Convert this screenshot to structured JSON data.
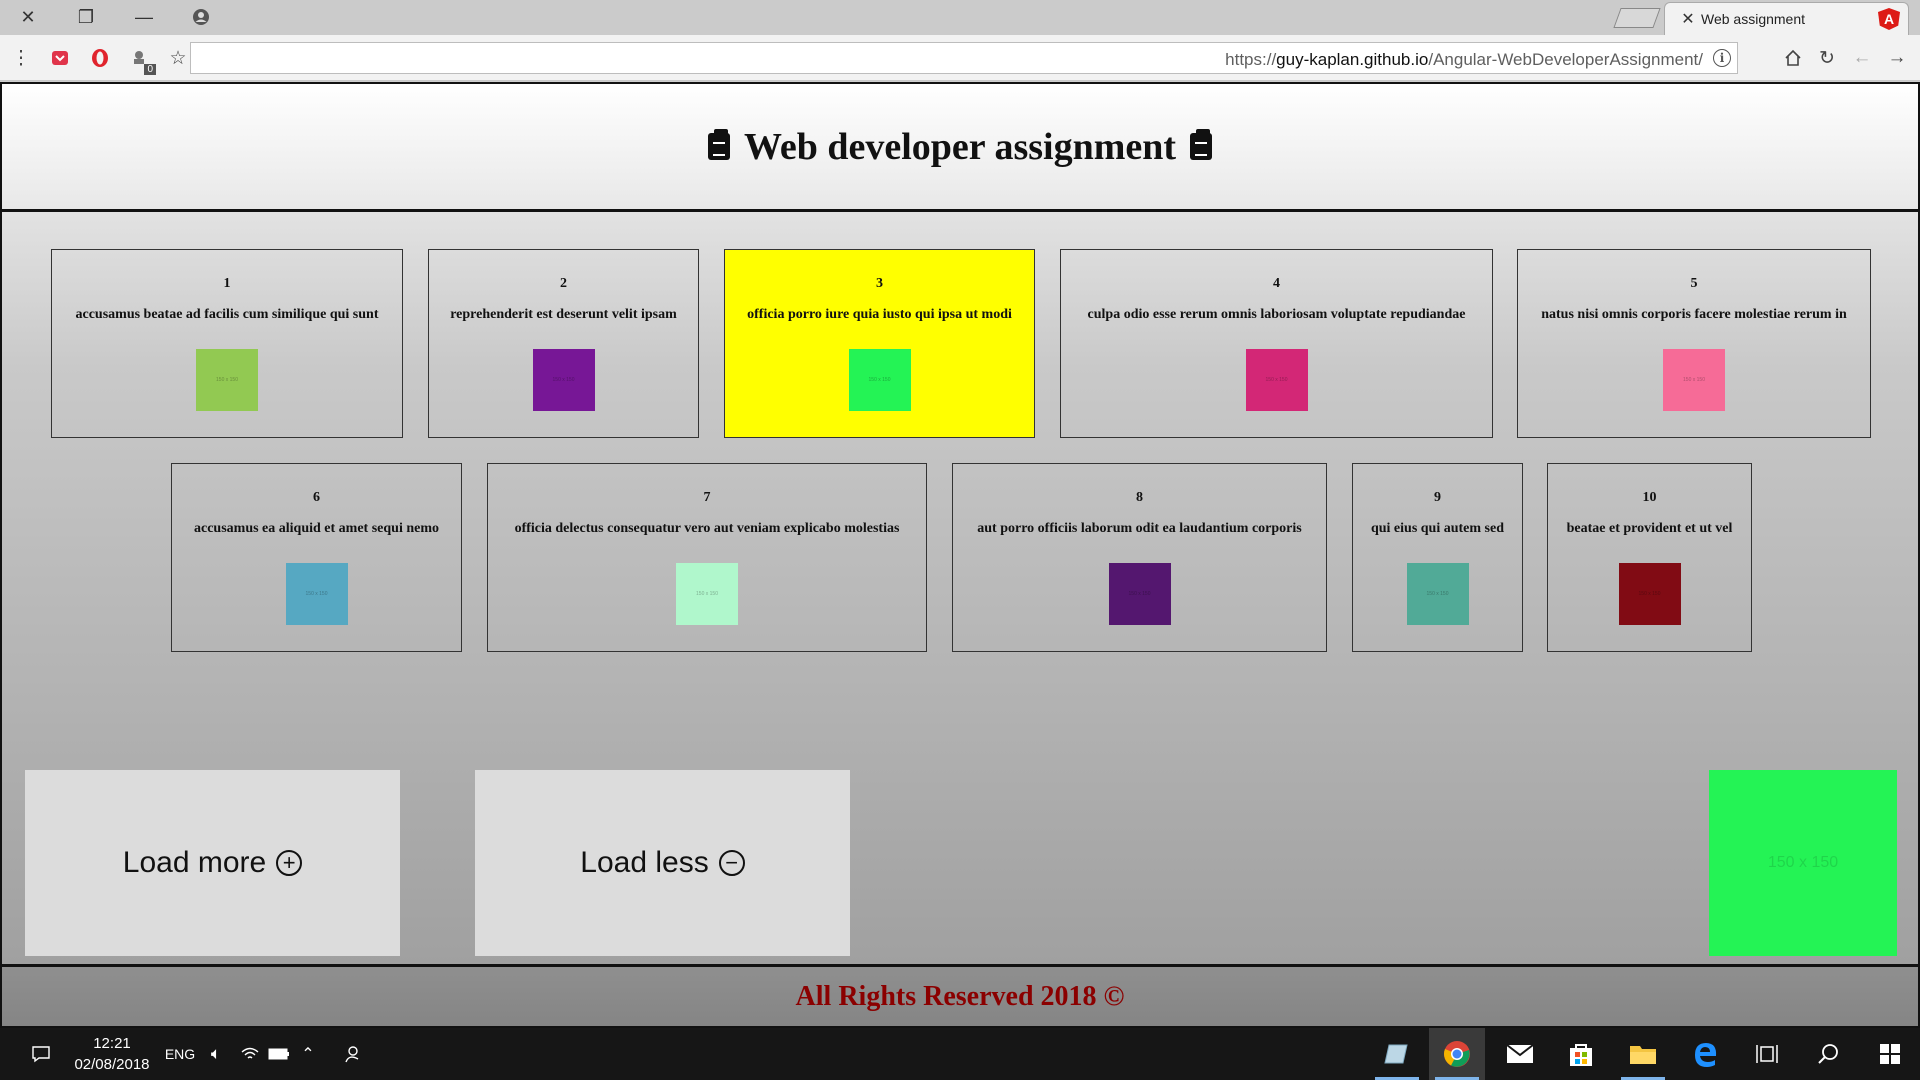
{
  "browser": {
    "tab_title": "Web assignment",
    "url_prefix": "https://",
    "url_host": "guy-kaplan.github.io",
    "url_path": "/Angular-WebDeveloperAssignment/",
    "extension_badge": "0"
  },
  "page": {
    "title": "Web developer assignment",
    "cards": [
      {
        "id": "1",
        "title": "accusamus beatae ad facilis cum similique qui sunt",
        "thumb_label": "150 x 150",
        "color": "#92c952",
        "selected": false
      },
      {
        "id": "2",
        "title": "reprehenderit est deserunt velit ipsam",
        "thumb_label": "150 x 150",
        "color": "#771796",
        "selected": false
      },
      {
        "id": "3",
        "title": "officia porro iure quia iusto qui ipsa ut modi",
        "thumb_label": "150 x 150",
        "color": "#24f355",
        "selected": true
      },
      {
        "id": "4",
        "title": "culpa odio esse rerum omnis laboriosam voluptate repudiandae",
        "thumb_label": "150 x 150",
        "color": "#d32776",
        "selected": false
      },
      {
        "id": "5",
        "title": "natus nisi omnis corporis facere molestiae rerum in",
        "thumb_label": "150 x 150",
        "color": "#f66b97",
        "selected": false
      },
      {
        "id": "6",
        "title": "accusamus ea aliquid et amet sequi nemo",
        "thumb_label": "150 x 150",
        "color": "#56a8c2",
        "selected": false
      },
      {
        "id": "7",
        "title": "officia delectus consequatur vero aut veniam explicabo molestias",
        "thumb_label": "150 x 150",
        "color": "#b0f7cc",
        "selected": false
      },
      {
        "id": "8",
        "title": "aut porro officiis laborum odit ea laudantium corporis",
        "thumb_label": "150 x 150",
        "color": "#54176f",
        "selected": false
      },
      {
        "id": "9",
        "title": "qui eius qui autem sed",
        "thumb_label": "150 x 150",
        "color": "#51aa97",
        "selected": false
      },
      {
        "id": "10",
        "title": "beatae et provident et ut vel",
        "thumb_label": "150 x 150",
        "color": "#810b14",
        "selected": false
      }
    ],
    "load_more_label": "Load more",
    "load_less_label": "Load less",
    "preview": {
      "label": "150 x 150",
      "color": "#24f355"
    },
    "footer": "All Rights Reserved 2018 ©"
  },
  "taskbar": {
    "time": "12:21",
    "date": "02/08/2018",
    "language": "ENG"
  },
  "colors": {
    "selected_card": "#ffff00",
    "footer_text": "#8b0000"
  }
}
